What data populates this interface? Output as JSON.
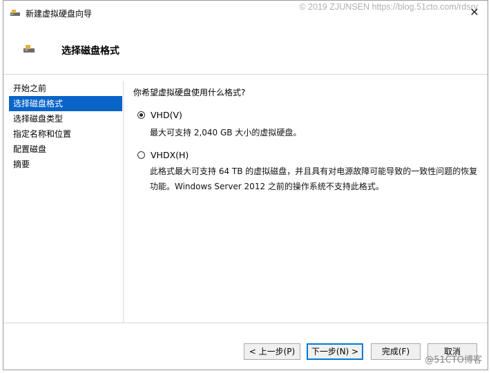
{
  "window": {
    "title": "新建虚拟硬盘向导",
    "close_glyph": "✕",
    "watermark": "© 2019 ZJUNSEN https://blog.51cto.com/rdsrv"
  },
  "header": {
    "title": "选择磁盘格式"
  },
  "nav": {
    "items": [
      {
        "label": "开始之前"
      },
      {
        "label": "选择磁盘格式"
      },
      {
        "label": "选择磁盘类型"
      },
      {
        "label": "指定名称和位置"
      },
      {
        "label": "配置磁盘"
      },
      {
        "label": "摘要"
      }
    ],
    "active_index": 1
  },
  "content": {
    "question": "你希望虚拟硬盘使用什么格式?",
    "options": [
      {
        "label": "VHD(V)",
        "selected": true,
        "description": "最大可支持 2,040 GB 大小的虚拟硬盘。"
      },
      {
        "label": "VHDX(H)",
        "selected": false,
        "description": "此格式最大可支持 64 TB 的虚拟磁盘，并且具有对电源故障可能导致的一致性问题的恢复功能。Windows Server 2012 之前的操作系统不支持此格式。"
      }
    ]
  },
  "footer": {
    "prev": "< 上一步(P)",
    "next": "下一步(N) >",
    "finish": "完成(F)",
    "cancel": "取消",
    "corner_watermark": "@51CTO博客"
  },
  "icons": {
    "window": "disk-wizard-icon",
    "header": "disk-icon"
  }
}
